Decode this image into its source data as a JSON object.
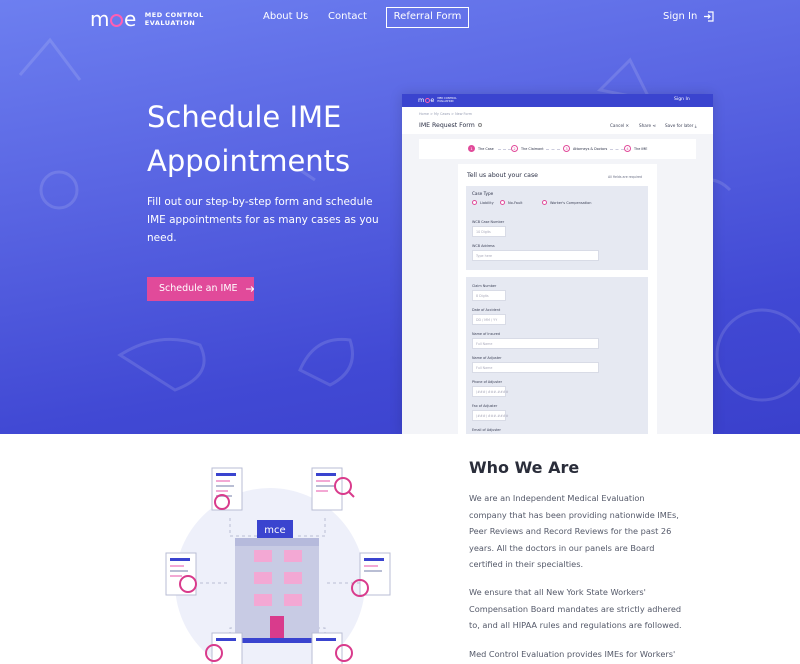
{
  "nav": {
    "logo_mark": "mce",
    "logo_line1": "MED CONTROL",
    "logo_line2": "EVALUATION",
    "about": "About Us",
    "contact": "Contact",
    "referral": "Referral Form",
    "signin": "Sign In"
  },
  "hero": {
    "title": "Schedule IME Appointments",
    "description": "Fill out our step-by-step form and schedule IME appointments for as many cases as you need.",
    "cta": "Schedule an IME"
  },
  "mockup": {
    "signin": "Sign In",
    "breadcrumb": "Home  >  My Cases  >  New Form",
    "title": "IME Request Form",
    "actions": {
      "cancel": "Cancel ✕",
      "share": "Share ⋖",
      "save": "Save for later ⤓"
    },
    "steps": [
      "The Case",
      "The Claimant",
      "Attorneys & Doctors",
      "The IME"
    ],
    "panel_title": "Tell us about your case",
    "required_note": "All fields are required",
    "case_type_label": "Case Type",
    "case_types": [
      "Liability",
      "No-Fault",
      "Worker's Compensation"
    ],
    "fields_box1": [
      {
        "label": "WCB Case Number",
        "placeholder": "10 Digits"
      },
      {
        "label": "WCB Address",
        "placeholder": "Type here"
      }
    ],
    "fields_box2": [
      {
        "label": "Claim Number",
        "placeholder": "8 Digits"
      },
      {
        "label": "Date of Accident",
        "placeholder": "DD / MM / YY"
      },
      {
        "label": "Name of Insured",
        "placeholder": "Full Name"
      },
      {
        "label": "Name of Adjuster",
        "placeholder": "Full Name"
      },
      {
        "label": "Phone of Adjuster",
        "placeholder": "(###) ###-####"
      },
      {
        "label": "Fax of Adjuster",
        "placeholder": "(###) ###-####"
      },
      {
        "label": "Email of Adjuster",
        "placeholder": ""
      }
    ]
  },
  "who": {
    "title": "Who We Are",
    "p1": "We are an Independent Medical Evaluation company that has been providing nationwide IMEs, Peer Reviews and Record Reviews for the past 26 years. All the doctors in our panels are Board certified in their specialties.",
    "p2": "We ensure that all New York State Workers' Compensation Board mandates are strictly adhered to, and all HIPAA rules and regulations are followed.",
    "p3": "Med Control Evaluation provides IMEs for Workers'",
    "building_sign": "mce"
  },
  "colors": {
    "accent": "#e14a9a",
    "hero_start": "#6d7ff0",
    "hero_end": "#3a40cc",
    "mock_bar": "#3a44cf"
  }
}
